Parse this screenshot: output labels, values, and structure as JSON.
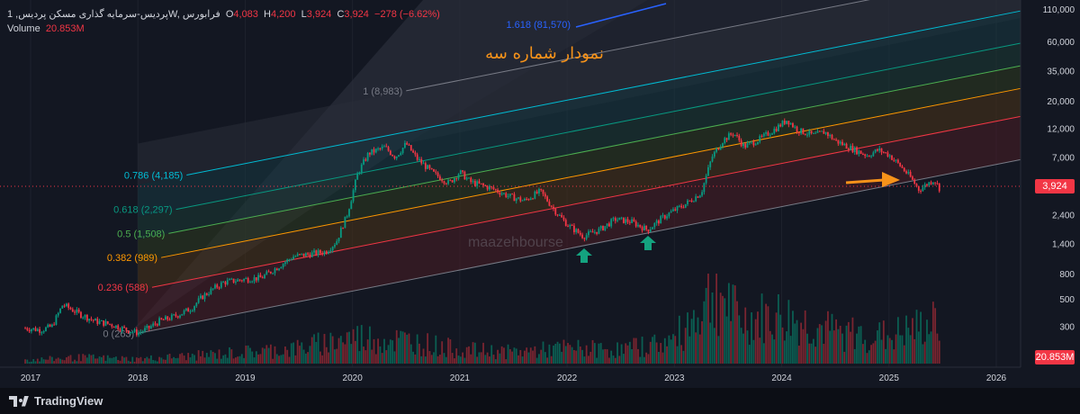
{
  "legend": {
    "title": "پردیس-سرمایه گذاری مسکن پردیس, 1W, فرابورس",
    "o_label": "O",
    "o_value": "4,083",
    "h_label": "H",
    "h_value": "4,200",
    "l_label": "L",
    "l_value": "3,924",
    "c_label": "C",
    "c_value": "3,924",
    "change": "−278 (−6.62%)",
    "volume_label": "Volume",
    "volume_value": "20.853M"
  },
  "annotation_title": "نمودار شماره سه",
  "watermark": "maazehbourse",
  "current_price_tag": "3,924",
  "current_volume_tag": "20.853M",
  "footer": {
    "brand": "TradingView"
  },
  "colors": {
    "background": "#131722",
    "up": "#089981",
    "down": "#f23645",
    "arrow_up": "#14a37f",
    "arrow_orange": "#f7931a",
    "title_orange": "#f7931a"
  },
  "chart_data": {
    "type": "candlestick",
    "y_scale": "log",
    "y_ticks": [
      "110,000",
      "60,000",
      "35,000",
      "20,000",
      "12,000",
      "7,000",
      "4,000",
      "2,400",
      "1,400",
      "800",
      "500",
      "300",
      "180"
    ],
    "x_ticks": [
      "2017",
      "2018",
      "2019",
      "2020",
      "2021",
      "2022",
      "2023",
      "2024",
      "2025",
      "2026"
    ],
    "fib_channel_levels": [
      {
        "level": "0",
        "value": "263",
        "label": "0 (263)",
        "color": "#787b86"
      },
      {
        "level": "0.236",
        "value": "588",
        "label": "0.236 (588)",
        "color": "#f23645"
      },
      {
        "level": "0.382",
        "value": "989",
        "label": "0.382 (989)",
        "color": "#ff9800"
      },
      {
        "level": "0.5",
        "value": "1,508",
        "label": "0.5 (1,508)",
        "color": "#4caf50"
      },
      {
        "level": "0.618",
        "value": "2,297",
        "label": "0.618 (2,297)",
        "color": "#089981"
      },
      {
        "level": "0.786",
        "value": "4,185",
        "label": "0.786 (4,185)",
        "color": "#00bcd4"
      },
      {
        "level": "1",
        "value": "8,983",
        "label": "1 (8,983)",
        "color": "#787b86"
      },
      {
        "level": "1.618",
        "value": "81,570",
        "label": "1.618 (81,570)",
        "color": "#2962ff"
      }
    ],
    "price_path": [
      [
        2016.95,
        290
      ],
      [
        2017.1,
        280
      ],
      [
        2017.2,
        300
      ],
      [
        2017.3,
        450
      ],
      [
        2017.45,
        380
      ],
      [
        2017.6,
        330
      ],
      [
        2017.75,
        310
      ],
      [
        2017.9,
        280
      ],
      [
        2018.0,
        265
      ],
      [
        2018.1,
        290
      ],
      [
        2018.2,
        330
      ],
      [
        2018.3,
        350
      ],
      [
        2018.4,
        380
      ],
      [
        2018.5,
        420
      ],
      [
        2018.6,
        520
      ],
      [
        2018.7,
        600
      ],
      [
        2018.8,
        680
      ],
      [
        2018.9,
        700
      ],
      [
        2019.0,
        720
      ],
      [
        2019.15,
        740
      ],
      [
        2019.3,
        900
      ],
      [
        2019.45,
        1100
      ],
      [
        2019.6,
        1150
      ],
      [
        2019.75,
        1200
      ],
      [
        2019.85,
        1450
      ],
      [
        2019.95,
        2400
      ],
      [
        2020.05,
        5200
      ],
      [
        2020.15,
        7500
      ],
      [
        2020.3,
        8400
      ],
      [
        2020.4,
        7000
      ],
      [
        2020.5,
        8983
      ],
      [
        2020.6,
        6800
      ],
      [
        2020.75,
        5200
      ],
      [
        2020.9,
        4300
      ],
      [
        2021.0,
        5300
      ],
      [
        2021.1,
        4400
      ],
      [
        2021.3,
        3900
      ],
      [
        2021.45,
        3400
      ],
      [
        2021.6,
        3100
      ],
      [
        2021.75,
        3700
      ],
      [
        2021.9,
        2500
      ],
      [
        2022.0,
        2000
      ],
      [
        2022.15,
        1600
      ],
      [
        2022.3,
        1800
      ],
      [
        2022.45,
        2200
      ],
      [
        2022.6,
        2100
      ],
      [
        2022.75,
        1800
      ],
      [
        2022.9,
        2300
      ],
      [
        2023.0,
        2600
      ],
      [
        2023.1,
        2900
      ],
      [
        2023.25,
        3600
      ],
      [
        2023.35,
        7000
      ],
      [
        2023.45,
        9500
      ],
      [
        2023.55,
        11000
      ],
      [
        2023.65,
        8500
      ],
      [
        2023.8,
        9800
      ],
      [
        2023.95,
        12000
      ],
      [
        2024.05,
        14000
      ],
      [
        2024.15,
        11500
      ],
      [
        2024.3,
        10500
      ],
      [
        2024.4,
        11200
      ],
      [
        2024.5,
        9500
      ],
      [
        2024.65,
        8200
      ],
      [
        2024.8,
        7200
      ],
      [
        2024.9,
        8000
      ],
      [
        2025.0,
        7300
      ],
      [
        2025.1,
        6000
      ],
      [
        2025.2,
        4800
      ],
      [
        2025.28,
        3800
      ],
      [
        2025.35,
        4200
      ],
      [
        2025.42,
        4600
      ],
      [
        2025.47,
        3924
      ]
    ],
    "volume_path": [
      [
        2017,
        0.05
      ],
      [
        2017.5,
        0.08
      ],
      [
        2018,
        0.06
      ],
      [
        2018.5,
        0.1
      ],
      [
        2019,
        0.15
      ],
      [
        2019.5,
        0.2
      ],
      [
        2020,
        0.35
      ],
      [
        2020.5,
        0.3
      ],
      [
        2021,
        0.18
      ],
      [
        2021.5,
        0.15
      ],
      [
        2022,
        0.2
      ],
      [
        2022.5,
        0.18
      ],
      [
        2023,
        0.3
      ],
      [
        2023.4,
        1.0
      ],
      [
        2023.6,
        0.55
      ],
      [
        2024,
        0.6
      ],
      [
        2024.5,
        0.4
      ],
      [
        2025,
        0.35
      ],
      [
        2025.4,
        0.5
      ]
    ]
  }
}
